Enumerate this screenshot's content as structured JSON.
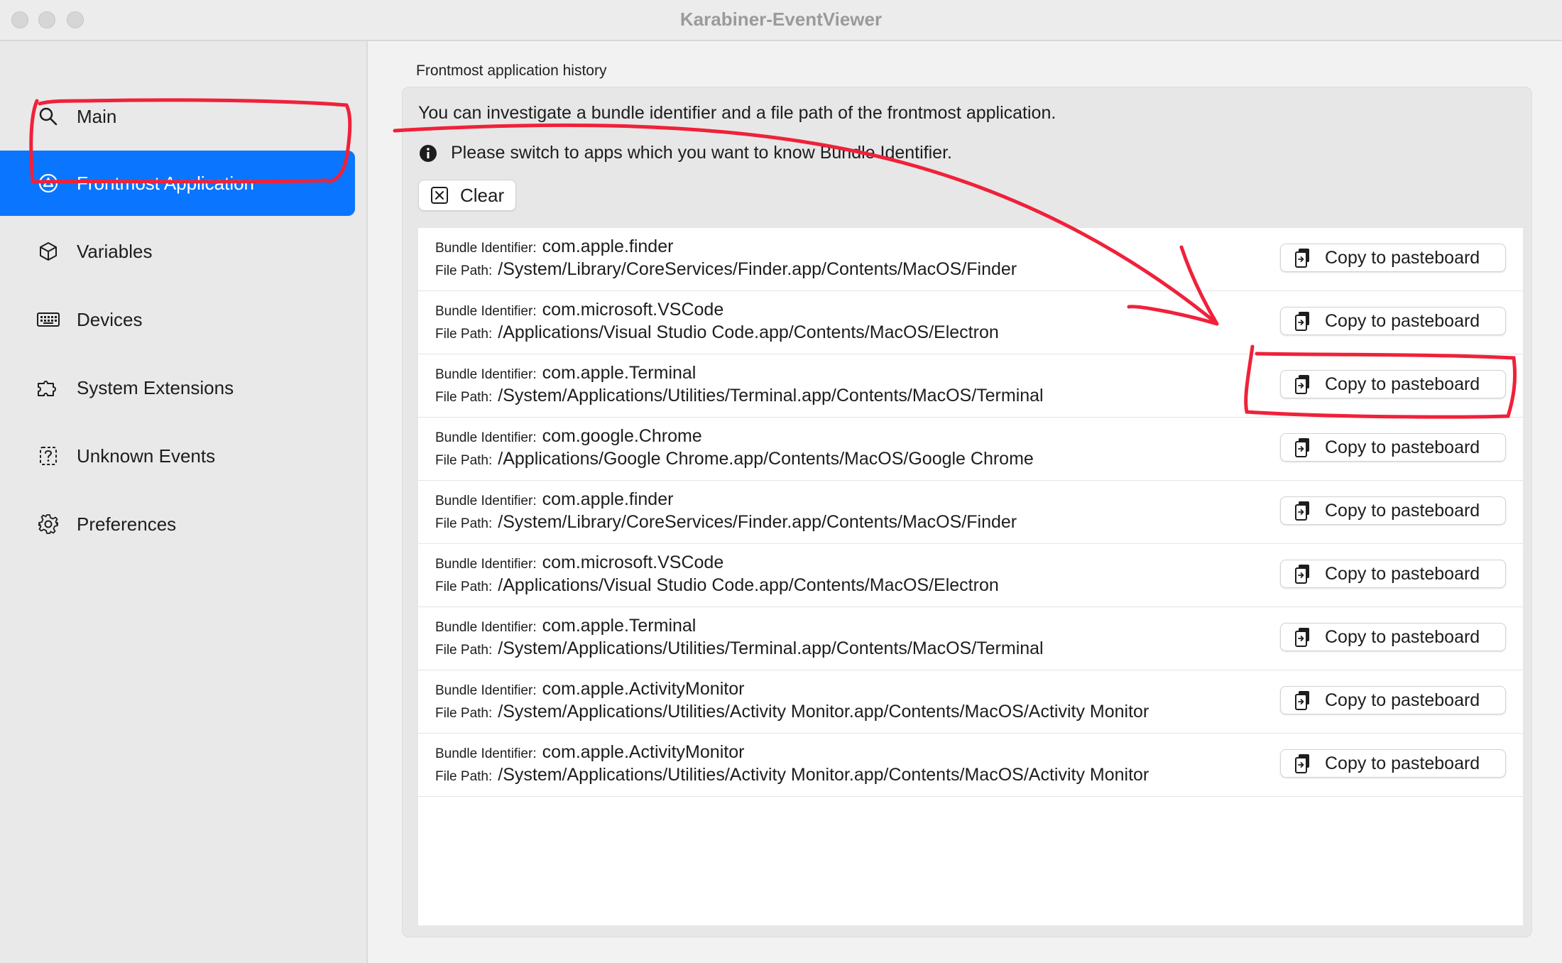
{
  "window": {
    "title": "Karabiner-EventViewer"
  },
  "sidebar": {
    "items": [
      {
        "label": "Main",
        "icon": "search-icon",
        "selected": false
      },
      {
        "label": "Frontmost Application",
        "icon": "app-triangle-icon",
        "selected": true
      },
      {
        "label": "Variables",
        "icon": "cube-icon",
        "selected": false
      },
      {
        "label": "Devices",
        "icon": "keyboard-icon",
        "selected": false
      },
      {
        "label": "System Extensions",
        "icon": "puzzle-icon",
        "selected": false
      },
      {
        "label": "Unknown Events",
        "icon": "question-square-icon",
        "selected": false
      },
      {
        "label": "Preferences",
        "icon": "gear-icon",
        "selected": false
      }
    ]
  },
  "main": {
    "section_title": "Frontmost application history",
    "intro": "You can investigate a bundle identifier and a file path of the frontmost application.",
    "info": "Please switch to apps which you want to know Bundle Identifier.",
    "clear_label": "Clear",
    "bundle_key": "Bundle Identifier:",
    "path_key": "File Path:",
    "copy_label": "Copy to pasteboard",
    "rows": [
      {
        "bundle": "com.apple.finder",
        "path": "/System/Library/CoreServices/Finder.app/Contents/MacOS/Finder"
      },
      {
        "bundle": "com.microsoft.VSCode",
        "path": "/Applications/Visual Studio Code.app/Contents/MacOS/Electron"
      },
      {
        "bundle": "com.apple.Terminal",
        "path": "/System/Applications/Utilities/Terminal.app/Contents/MacOS/Terminal"
      },
      {
        "bundle": "com.google.Chrome",
        "path": "/Applications/Google Chrome.app/Contents/MacOS/Google Chrome"
      },
      {
        "bundle": "com.apple.finder",
        "path": "/System/Library/CoreServices/Finder.app/Contents/MacOS/Finder"
      },
      {
        "bundle": "com.microsoft.VSCode",
        "path": "/Applications/Visual Studio Code.app/Contents/MacOS/Electron"
      },
      {
        "bundle": "com.apple.Terminal",
        "path": "/System/Applications/Utilities/Terminal.app/Contents/MacOS/Terminal"
      },
      {
        "bundle": "com.apple.ActivityMonitor",
        "path": "/System/Applications/Utilities/Activity Monitor.app/Contents/MacOS/Activity Monitor"
      },
      {
        "bundle": "com.apple.ActivityMonitor",
        "path": "/System/Applications/Utilities/Activity Monitor.app/Contents/MacOS/Activity Monitor"
      }
    ]
  },
  "colors": {
    "accent": "#0a76ff",
    "annotation": "#f0213a"
  }
}
